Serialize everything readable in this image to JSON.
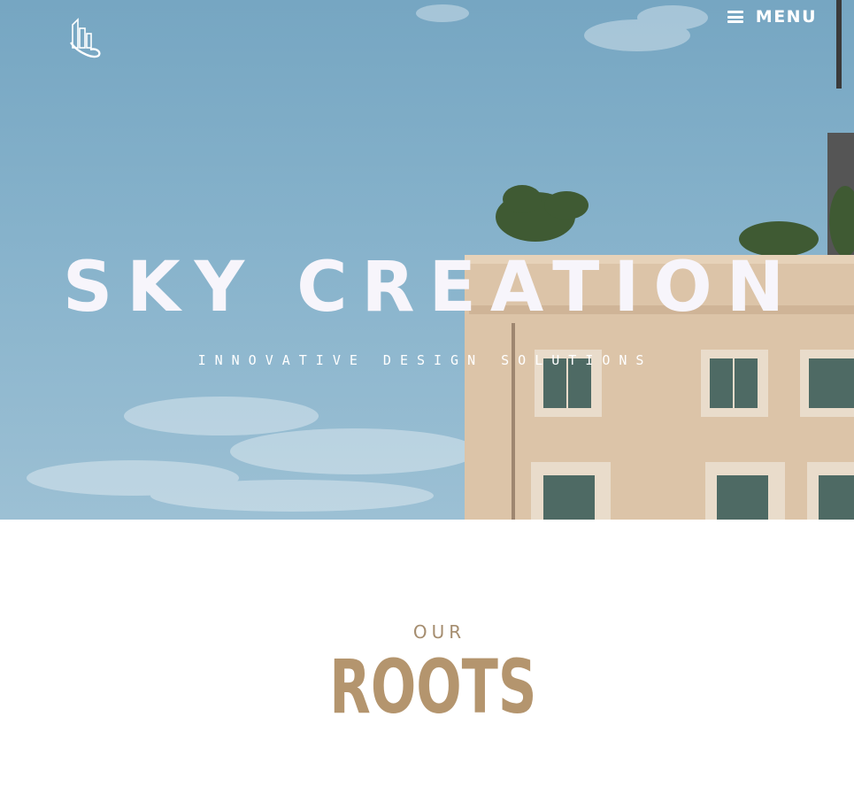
{
  "header": {
    "logo_icon": "building-logo-icon",
    "menu_icon": "hamburger-icon",
    "menu_label": "MENU"
  },
  "hero": {
    "title": "SKY CREATION",
    "subtitle": "INNOVATIVE DESIGN SOLUTIONS",
    "background_image": "building-against-sky"
  },
  "section": {
    "kicker": "OUR",
    "title": "ROOTS"
  },
  "colors": {
    "sky": "#7aa8c4",
    "building": "#dcc4a8",
    "accent": "#b4956e",
    "white": "#ffffff"
  }
}
